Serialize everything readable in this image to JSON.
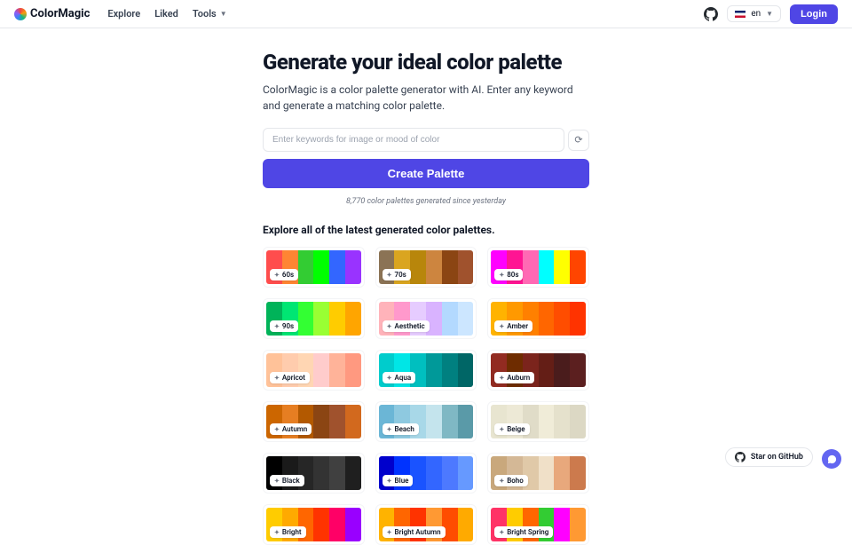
{
  "header": {
    "brand": "ColorMagic",
    "nav": {
      "explore": "Explore",
      "liked": "Liked",
      "tools": "Tools"
    },
    "lang": "en",
    "login": "Login"
  },
  "hero": {
    "title": "Generate your ideal color palette",
    "subtitle": "ColorMagic is a color palette generator with AI. Enter any keyword and generate a matching color palette.",
    "placeholder": "Enter keywords for image or mood of color",
    "create": "Create Palette",
    "stats": "8,770 color palettes generated since yesterday"
  },
  "explore": {
    "title": "Explore all of the latest generated color palettes.",
    "palettes": [
      {
        "label": "60s",
        "colors": [
          "#ff4d4d",
          "#ff8533",
          "#33cc33",
          "#00ff00",
          "#3366ff",
          "#9933ff"
        ]
      },
      {
        "label": "70s",
        "colors": [
          "#8b7355",
          "#daa520",
          "#b8860b",
          "#cd853f",
          "#8b4513",
          "#a0522d"
        ]
      },
      {
        "label": "80s",
        "colors": [
          "#ff00ff",
          "#ff1493",
          "#ff69b4",
          "#00ffff",
          "#ffff00",
          "#ff4500"
        ]
      },
      {
        "label": "90s",
        "colors": [
          "#00b359",
          "#00e673",
          "#33ff33",
          "#99ff33",
          "#ffcc00",
          "#ffa500"
        ]
      },
      {
        "label": "Aesthetic",
        "colors": [
          "#ffb3ba",
          "#ff99cc",
          "#e6ccff",
          "#d9b3ff",
          "#b3d9ff",
          "#cce6ff"
        ]
      },
      {
        "label": "Amber",
        "colors": [
          "#ffb300",
          "#ff9900",
          "#ff8000",
          "#ff6600",
          "#ff4d00",
          "#ff3300"
        ]
      },
      {
        "label": "Apricot",
        "colors": [
          "#ffc299",
          "#ffccad",
          "#ffd6b3",
          "#ffcccc",
          "#ffb399",
          "#ff9980"
        ]
      },
      {
        "label": "Aqua",
        "colors": [
          "#00cccc",
          "#00e6e6",
          "#00bfbf",
          "#009999",
          "#008080",
          "#006666"
        ]
      },
      {
        "label": "Auburn",
        "colors": [
          "#922b21",
          "#6e2c00",
          "#7b241c",
          "#641e16",
          "#4a1c1c",
          "#5b1f1f"
        ]
      },
      {
        "label": "Autumn",
        "colors": [
          "#cc6600",
          "#e67e22",
          "#b35900",
          "#8b4513",
          "#a0522d",
          "#d2691e"
        ]
      },
      {
        "label": "Beach",
        "colors": [
          "#6bb6d6",
          "#8ec9e0",
          "#a8d8e8",
          "#c4e4ed",
          "#7fb8c4",
          "#5a9aa8"
        ]
      },
      {
        "label": "Beige",
        "colors": [
          "#e8e5d0",
          "#ede9d6",
          "#e0dcc8",
          "#f0ecd8",
          "#e5e1cc",
          "#dcd8c4"
        ]
      },
      {
        "label": "Black",
        "colors": [
          "#000000",
          "#1a1a1a",
          "#262626",
          "#333333",
          "#404040",
          "#1f1f1f"
        ]
      },
      {
        "label": "Blue",
        "colors": [
          "#0000cc",
          "#0033ff",
          "#1a53ff",
          "#3366ff",
          "#4d79ff",
          "#6699ff"
        ]
      },
      {
        "label": "Boho",
        "colors": [
          "#c9a87c",
          "#d4b896",
          "#e0c9a8",
          "#f0e0c8",
          "#e8a87c",
          "#cc7a4d"
        ]
      },
      {
        "label": "Bright",
        "colors": [
          "#ffcc00",
          "#ffaa00",
          "#ff6600",
          "#ff3300",
          "#ff0066",
          "#9900ff"
        ]
      },
      {
        "label": "Bright Autumn",
        "colors": [
          "#ffb300",
          "#ff6600",
          "#ff3300",
          "#ff9933",
          "#ff4d00",
          "#ffaa00"
        ]
      },
      {
        "label": "Bright Spring",
        "colors": [
          "#ff3366",
          "#ffcc00",
          "#ff6600",
          "#33cc33",
          "#ff00ff",
          "#ff9933"
        ]
      }
    ]
  },
  "footer": {
    "github_star": "Star on GitHub"
  }
}
